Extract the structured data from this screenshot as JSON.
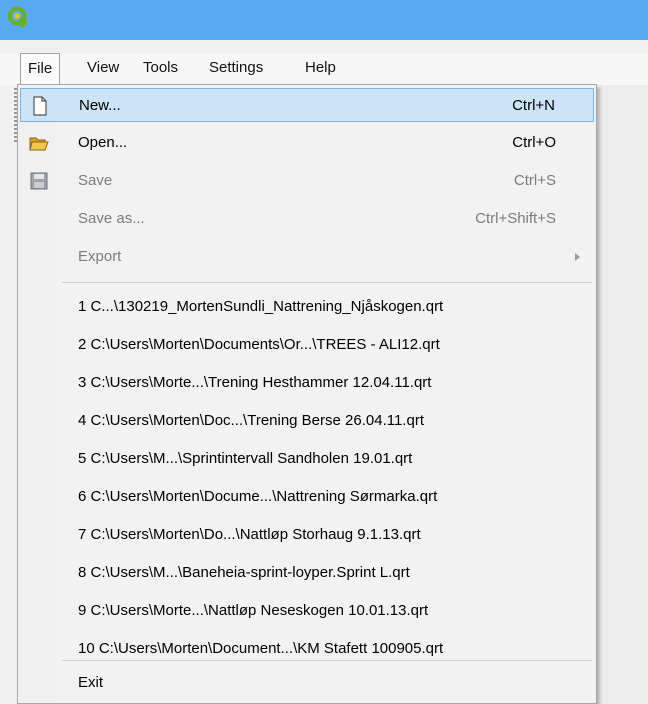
{
  "menubar": {
    "items": [
      {
        "label": "File"
      },
      {
        "label": "View"
      },
      {
        "label": "Tools"
      },
      {
        "label": "Settings"
      },
      {
        "label": "Help"
      }
    ]
  },
  "file_menu": {
    "actions": [
      {
        "label": "New...",
        "shortcut": "Ctrl+N",
        "icon": "new-document-icon",
        "enabled": true,
        "highlighted": true
      },
      {
        "label": "Open...",
        "shortcut": "Ctrl+O",
        "icon": "open-folder-icon",
        "enabled": true
      },
      {
        "label": "Save",
        "shortcut": "Ctrl+S",
        "icon": "save-disk-icon",
        "enabled": false
      },
      {
        "label": "Save as...",
        "shortcut": "Ctrl+Shift+S",
        "enabled": false
      },
      {
        "label": "Export",
        "enabled": false,
        "submenu": true
      }
    ],
    "recent_files": [
      "1 C...\\130219_MortenSundli_Nattrening_Njåskogen.qrt",
      "2 C:\\Users\\Morten\\Documents\\Or...\\TREES - ALI12.qrt",
      "3 C:\\Users\\Morte...\\Trening Hesthammer 12.04.11.qrt",
      "4 C:\\Users\\Morten\\Doc...\\Trening Berse 26.04.11.qrt",
      "5 C:\\Users\\M...\\Sprintintervall Sandholen 19.01.qrt",
      "6 C:\\Users\\Morten\\Docume...\\Nattrening Sørmarka.qrt",
      "7 C:\\Users\\Morten\\Do...\\Nattløp Storhaug 9.1.13.qrt",
      "8 C:\\Users\\M...\\Baneheia-sprint-loyper.Sprint L.qrt",
      "9 C:\\Users\\Morte...\\Nattløp Neseskogen 10.01.13.qrt",
      "10 C:\\Users\\Morten\\Document...\\KM Stafett 100905.qrt"
    ],
    "exit_label": "Exit"
  },
  "colors": {
    "titlebar": "#59abf1",
    "highlight": "#cce4f7",
    "highlight_border": "#7eb4ea",
    "disabled_text": "#7c7c7c",
    "app_icon": "#6ab023"
  }
}
